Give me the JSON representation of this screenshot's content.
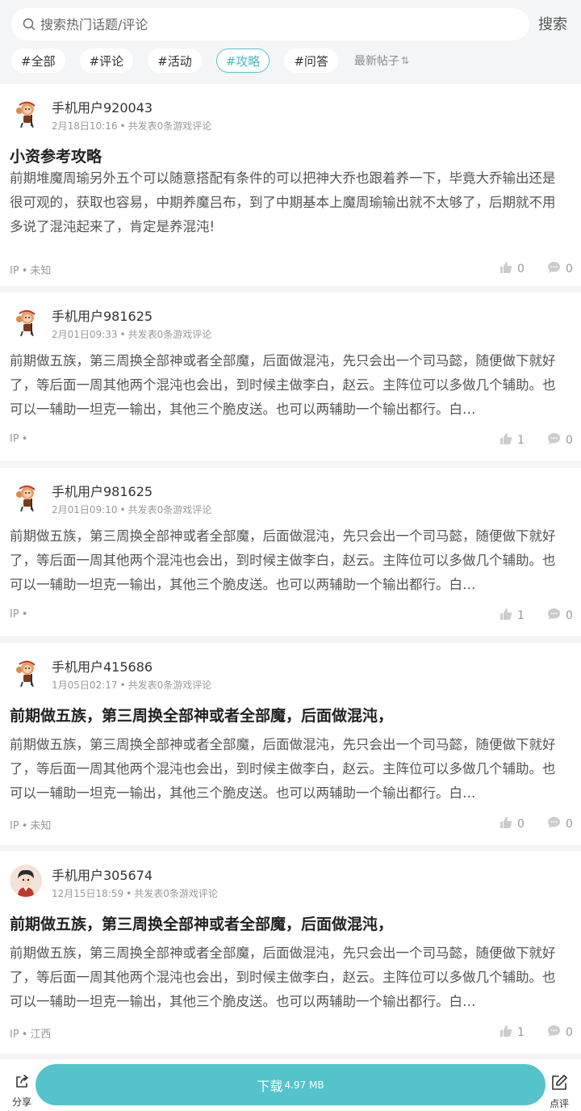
{
  "search": {
    "placeholder": "搜索热门话题/评论",
    "button_label": "搜索"
  },
  "tabs": [
    {
      "label": "#全部",
      "active": false
    },
    {
      "label": "#评论",
      "active": false
    },
    {
      "label": "#活动",
      "active": false
    },
    {
      "label": "#攻略",
      "active": true
    },
    {
      "label": "#问答",
      "active": false
    }
  ],
  "sort_label": "最新帖子",
  "posts": [
    {
      "username": "手机用户920043",
      "date": "2月18日10:16",
      "stats": "共发表0条游戏评论",
      "title": "小资参考攻略",
      "content": "前期堆魔周瑜另外五个可以随意搭配有条件的可以把神大乔也跟着养一下，毕竟大乔输出还是很可观的，获取也容易，中期养魔吕布，到了中期基本上魔周瑜输出就不太够了，后期就不用多说了混沌起来了，肯定是养混沌!",
      "ip_label": "IP",
      "ip_location": "未知",
      "likes": "0",
      "comments": "0",
      "avatar": "monkey-avatar"
    },
    {
      "username": "手机用户981625",
      "date": "2月01日09:33",
      "stats": "共发表0条游戏评论",
      "title": "",
      "content": "前期做五族，第三周换全部神或者全部魔，后面做混沌，先只会出一个司马懿，随便做下就好了，等后面一周其他两个混沌也会出，到时候主做李白，赵云。主阵位可以多做几个辅助。也可以一辅助一坦克一输出，其他三个脆皮送。也可以两辅助一个输出都行。白…",
      "ip_label": "IP",
      "ip_location": "",
      "likes": "1",
      "comments": "0",
      "avatar": "monkey-avatar"
    },
    {
      "username": "手机用户981625",
      "date": "2月01日09:10",
      "stats": "共发表0条游戏评论",
      "title": "",
      "content": "前期做五族，第三周换全部神或者全部魔，后面做混沌，先只会出一个司马懿，随便做下就好了，等后面一周其他两个混沌也会出，到时候主做李白，赵云。主阵位可以多做几个辅助。也可以一辅助一坦克一输出，其他三个脆皮送。也可以两辅助一个输出都行。白…",
      "ip_label": "IP",
      "ip_location": "",
      "likes": "1",
      "comments": "0",
      "avatar": "monkey-avatar"
    },
    {
      "username": "手机用户415686",
      "date": "1月05日02:17",
      "stats": "共发表0条游戏评论",
      "title": "前期做五族，第三周换全部神或者全部魔，后面做混沌，",
      "content": "前期做五族，第三周换全部神或者全部魔，后面做混沌，先只会出一个司马懿，随便做下就好了，等后面一周其他两个混沌也会出，到时候主做李白，赵云。主阵位可以多做几个辅助。也可以一辅助一坦克一输出，其他三个脆皮送。也可以两辅助一个输出都行。白…",
      "ip_label": "IP",
      "ip_location": "未知",
      "likes": "0",
      "comments": "0",
      "avatar": "monkey-avatar"
    },
    {
      "username": "手机用户305674",
      "date": "12月15日18:59",
      "stats": "共发表0条游戏评论",
      "title": "前期做五族，第三周换全部神或者全部魔，后面做混沌，",
      "content": "前期做五族，第三周换全部神或者全部魔，后面做混沌，先只会出一个司马懿，随便做下就好了，等后面一周其他两个混沌也会出，到时候主做李白，赵云。主阵位可以多做几个辅助。也可以一辅助一坦克一输出，其他三个脆皮送。也可以两辅助一个输出都行。白…",
      "ip_label": "IP",
      "ip_location": "江西",
      "likes": "1",
      "comments": "0",
      "avatar": "boy-avatar"
    }
  ],
  "bottom_bar": {
    "share_label": "分享",
    "download_label": "下载",
    "download_size": "4.97 MB",
    "review_label": "点评"
  },
  "colors": {
    "accent": "#55c3cb",
    "background": "#f4f5f6"
  }
}
